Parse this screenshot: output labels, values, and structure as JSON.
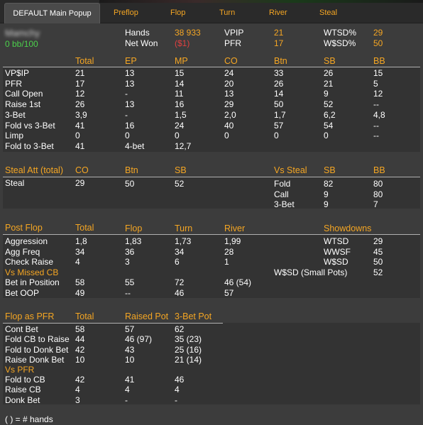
{
  "tabs": [
    {
      "label": "DEFAULT Main Popup"
    },
    {
      "label": "Preflop"
    },
    {
      "label": "Flop"
    },
    {
      "label": "Turn"
    },
    {
      "label": "River"
    },
    {
      "label": "Steal"
    }
  ],
  "player": {
    "name": "Mamchy",
    "bb100": "0 bb/100",
    "hands_label": "Hands",
    "hands_value": "38 933",
    "netwon_label": "Net Won",
    "netwon_value": "($1)",
    "vpip_label": "VPIP",
    "vpip_value": "21",
    "pfr_label": "PFR",
    "pfr_value": "17",
    "wtsd_label": "WTSD%",
    "wtsd_value": "29",
    "wsd_label": "W$SD%",
    "wsd_value": "50"
  },
  "preflop": {
    "headers": [
      "Total",
      "EP",
      "MP",
      "CO",
      "Btn",
      "SB",
      "BB"
    ],
    "rows": [
      {
        "label": "VP$IP",
        "values": [
          "21",
          "13",
          "15",
          "24",
          "33",
          "26",
          "15"
        ]
      },
      {
        "label": "PFR",
        "values": [
          "17",
          "13",
          "14",
          "20",
          "26",
          "21",
          "5"
        ]
      },
      {
        "label": "Call Open",
        "values": [
          "12",
          "-",
          "11",
          "13",
          "14",
          "9",
          "12"
        ]
      },
      {
        "label": "Raise 1st",
        "values": [
          "26",
          "13",
          "16",
          "29",
          "50",
          "52",
          "--"
        ]
      },
      {
        "label": "3-Bet",
        "values": [
          "3,9",
          "-",
          "1,5",
          "2,0",
          "1,7",
          "6,2",
          "4,8"
        ]
      },
      {
        "label": "Fold vs 3-Bet",
        "values": [
          "41",
          "16",
          "24",
          "40",
          "57",
          "54",
          "--"
        ]
      },
      {
        "label": "Limp",
        "values": [
          "0",
          "0",
          "0",
          "0",
          "0",
          "0",
          "--"
        ]
      },
      {
        "label": "Fold to 3-Bet",
        "values": [
          "41",
          "4-bet",
          "12,7",
          "",
          "",
          "",
          ""
        ]
      }
    ]
  },
  "steal": {
    "title": "Steal Att (total)",
    "headers": [
      "CO",
      "Btn",
      "SB"
    ],
    "row_label": "Steal",
    "row_values": [
      "29",
      "50",
      "52"
    ],
    "vs_title": "Vs Steal",
    "vs_headers": [
      "SB",
      "BB"
    ],
    "vs_rows": [
      {
        "label": "Fold",
        "values": [
          "82",
          "80"
        ]
      },
      {
        "label": "Call",
        "values": [
          "9",
          "80"
        ]
      },
      {
        "label": "3-Bet",
        "values": [
          "9",
          "7"
        ]
      }
    ]
  },
  "postflop": {
    "title": "Post Flop",
    "headers": [
      "Total",
      "Flop",
      "Turn",
      "River"
    ],
    "rows": [
      {
        "label": "Aggression",
        "values": [
          "1,8",
          "1,83",
          "1,73",
          "1,99"
        ]
      },
      {
        "label": "Agg Freq",
        "values": [
          "34",
          "36",
          "34",
          "28"
        ]
      },
      {
        "label": "Check Raise",
        "values": [
          "4",
          "3",
          "6",
          "1"
        ]
      }
    ],
    "missed_cb_title": "Vs Missed CB",
    "missed_rows": [
      {
        "label": "Bet in Position",
        "values": [
          "58",
          "55",
          "72",
          "46 (54)"
        ]
      },
      {
        "label": "Bet OOP",
        "values": [
          "49",
          "--",
          "46",
          "57"
        ]
      }
    ],
    "showdowns_title": "Showdowns",
    "showdowns": [
      {
        "label": "WTSD",
        "value": "29"
      },
      {
        "label": "WWSF",
        "value": "45"
      },
      {
        "label": "W$SD",
        "value": "50"
      },
      {
        "label": "W$SD (Small Pots)",
        "value": "52"
      }
    ]
  },
  "flop_pfr": {
    "title": "Flop as PFR",
    "headers": [
      "Total",
      "Raised Pot",
      "3-Bet Pot"
    ],
    "rows": [
      {
        "label": "Cont Bet",
        "values": [
          "58",
          "57",
          "62"
        ]
      },
      {
        "label": "Fold CB to Raise",
        "values": [
          "44",
          "46 (97)",
          "35 (23)"
        ]
      },
      {
        "label": "Fold to Donk Bet",
        "values": [
          "42",
          "43",
          "25 (16)"
        ]
      },
      {
        "label": "Raise Donk Bet",
        "values": [
          "10",
          "10",
          "21 (14)"
        ]
      }
    ],
    "vs_pfr_title": "Vs PFR",
    "vs_rows": [
      {
        "label": "Fold to CB",
        "values": [
          "42",
          "41",
          "46"
        ]
      },
      {
        "label": "Raise CB",
        "values": [
          "4",
          "4",
          "4"
        ]
      },
      {
        "label": "Donk Bet",
        "values": [
          "3",
          "-",
          "-"
        ]
      }
    ]
  },
  "footer": {
    "note": "( ) = # hands"
  },
  "colors": {
    "accent": "#f5a623",
    "negative": "#e04040",
    "positive": "#4cd04c",
    "background": "#3c3c3c",
    "band": "#333333"
  }
}
